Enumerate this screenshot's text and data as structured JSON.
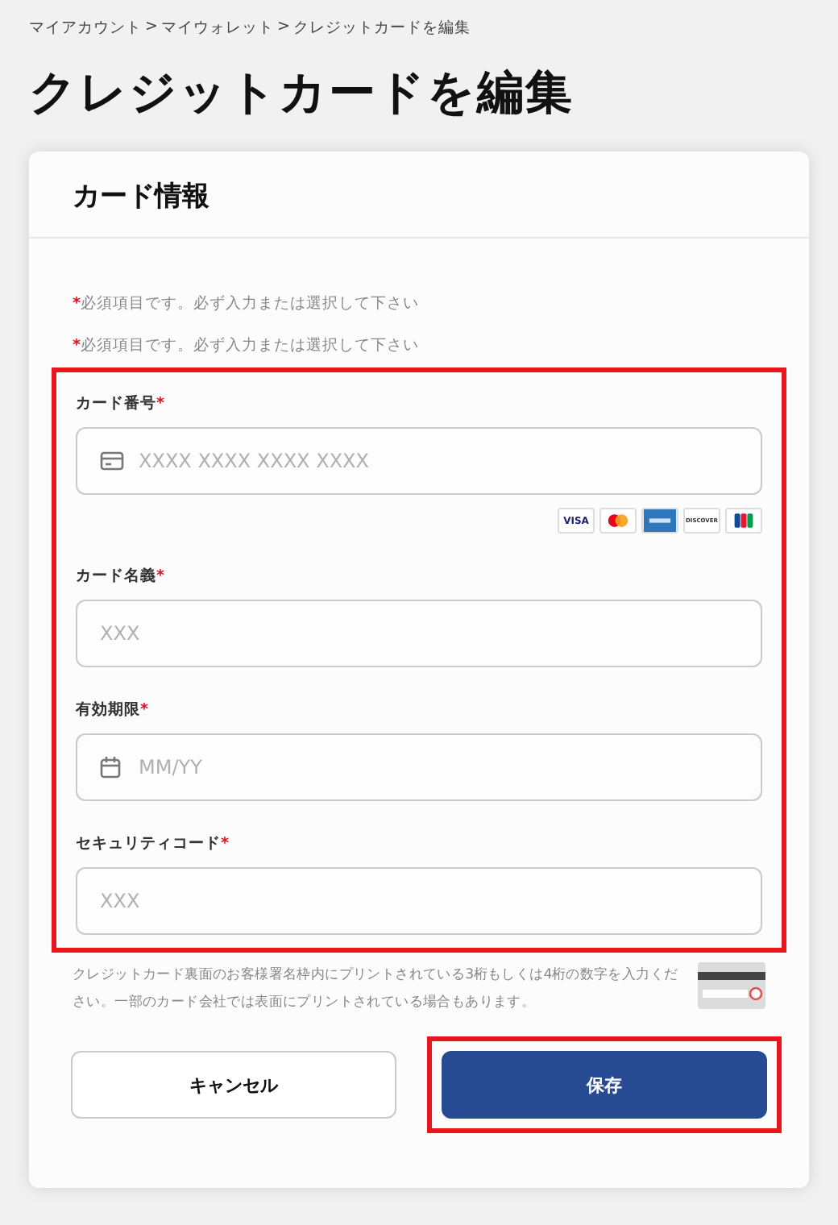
{
  "breadcrumb": [
    "マイアカウント",
    "マイウォレット",
    "クレジットカードを編集"
  ],
  "breadcrumb_separator": ">",
  "page_title": "クレジットカードを編集",
  "card": {
    "title": "カード情報",
    "required_notes": [
      {
        "mark": "*",
        "text": "必須項目です。必ず入力または選択して下さい"
      },
      {
        "mark": "*",
        "text": "必須項目です。必ず入力または選択して下さい"
      }
    ],
    "fields_highlighted": true,
    "fields": [
      {
        "kind": "card",
        "label": "カード番号",
        "required_mark": "*",
        "placeholder": "XXXX XXXX XXXX XXXX"
      },
      {
        "kind": "text",
        "label": "カード名義",
        "required_mark": "*",
        "placeholder": "XXX"
      },
      {
        "kind": "date",
        "label": "有効期限",
        "required_mark": "*",
        "placeholder": "MM/YY"
      },
      {
        "kind": "text",
        "label": "セキュリティコード",
        "required_mark": "*",
        "placeholder": "XXX"
      }
    ],
    "card_brands": [
      {
        "kind": "visa",
        "label": "VISA"
      },
      {
        "kind": "mastercard"
      },
      {
        "kind": "amex"
      },
      {
        "kind": "discover",
        "label": "DISCOVER"
      },
      {
        "kind": "jcb"
      }
    ],
    "security_help": "クレジットカード裏面のお客様署名枠内にプリントされている3桁もしくは4桁の数字を入力ください。一部のカード会社では表面にプリントされている場合もあります。",
    "buttons": [
      {
        "kind": "secondary",
        "label": "キャンセル",
        "highlighted": false
      },
      {
        "kind": "primary",
        "label": "保存",
        "highlighted": true
      }
    ]
  }
}
